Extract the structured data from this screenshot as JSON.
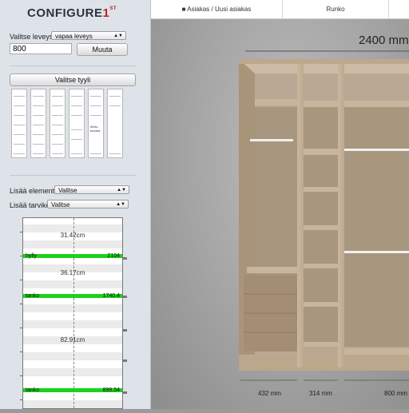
{
  "logo": {
    "main": "CONFIGURE",
    "number": "1",
    "sup": "ST"
  },
  "width_panel": {
    "label": "Valitse leveys:",
    "mode_value": "vapaa leveys",
    "input_value": "800",
    "change_button": "Muuta"
  },
  "style_button": "Valitse tyyli",
  "style_thumbnails": [
    "style-1",
    "style-2",
    "style-3",
    "style-4",
    "style-5",
    "style-6"
  ],
  "style_thumb_text": "Aihio-\nkuvake",
  "add_element": {
    "label": "Lisää elementti",
    "value": "Valitse"
  },
  "add_accessory": {
    "label": "Lisää tarvike",
    "value": "Valitse"
  },
  "editor": {
    "measurements": [
      "31.42cm",
      "36.17cm",
      "82.91cm"
    ],
    "shelves": [
      {
        "label": "hylly",
        "value": "2104"
      },
      {
        "label": "tanko",
        "value": "1740.4"
      },
      {
        "label": "tanko",
        "value": "899.54"
      }
    ]
  },
  "topbar": {
    "user_icon": "user-icon",
    "customer": "Asiakas / Uusi asiakas",
    "tab": "Runko"
  },
  "viewport": {
    "total_width": "2400 mm",
    "section_widths": [
      "432 mm",
      "314 mm",
      "800 mm"
    ]
  }
}
